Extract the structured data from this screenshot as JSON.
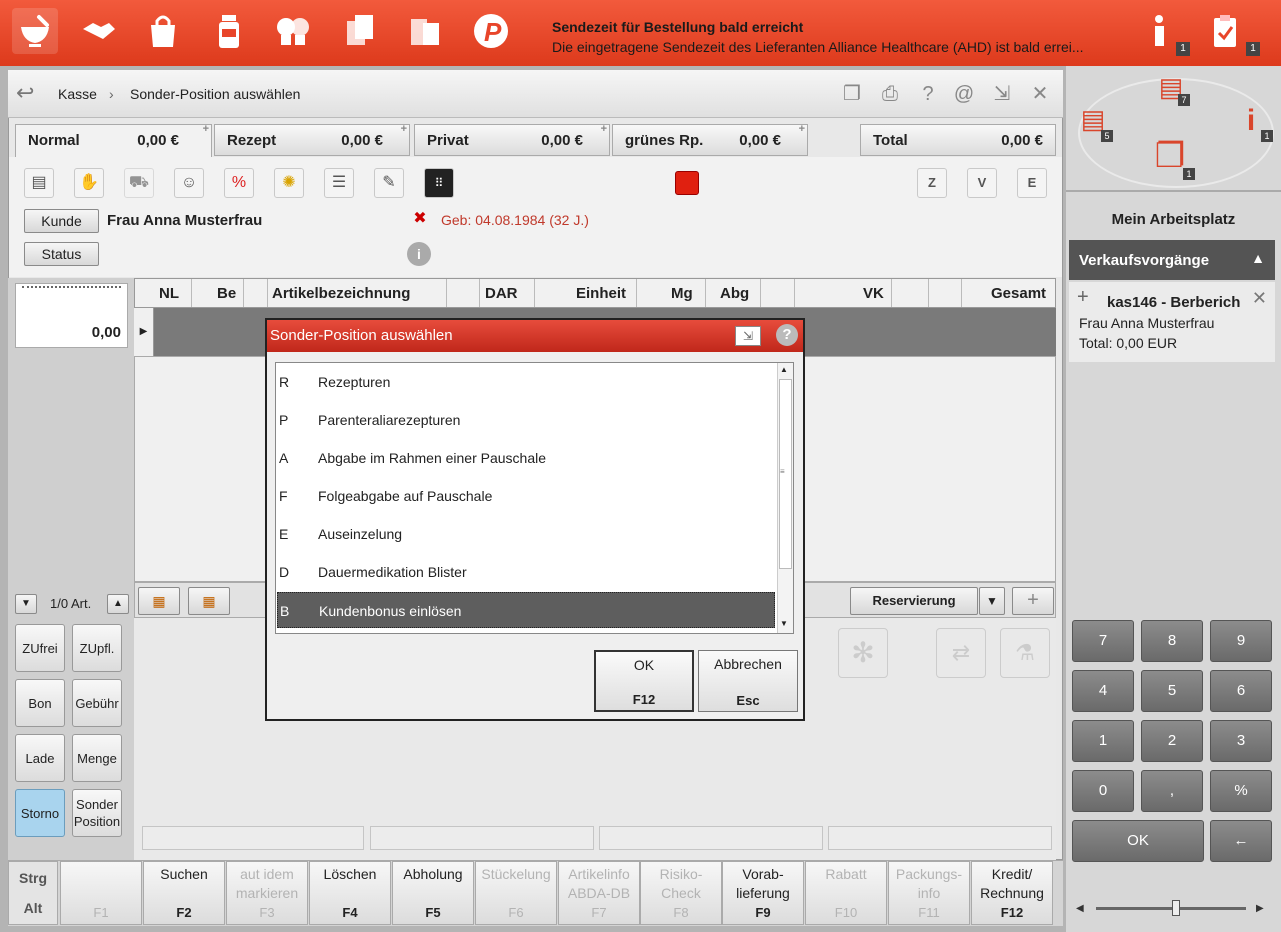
{
  "topbar": {
    "icons": [
      "mortar-icon",
      "handshake-icon",
      "shopping-bag-icon",
      "pill-bottle-icon",
      "consultation-icon",
      "documents-icon",
      "files-icon",
      "p-logo-icon"
    ],
    "notification_title": "Sendezeit für Bestellung bald erreicht",
    "notification_text": "Die eingetragene Sendezeit des Lieferanten Alliance Healthcare (AHD) ist bald errei...",
    "info_badge": "1",
    "task_badge": "1"
  },
  "breadcrumb": {
    "root": "Kasse",
    "sep": "›",
    "current": "Sonder-Position auswählen"
  },
  "tabs": [
    {
      "label": "Normal",
      "value": "0,00 €"
    },
    {
      "label": "Rezept",
      "value": "0,00 €"
    },
    {
      "label": "Privat",
      "value": "0,00 €"
    },
    {
      "label": "grünes Rp.",
      "value": "0,00 €"
    }
  ],
  "total": {
    "label": "Total",
    "value": "0,00 €"
  },
  "customer": {
    "kunde_button": "Kunde",
    "name": "Frau Anna Musterfrau",
    "status_button": "Status",
    "birth": "Geb: 04.08.1984 (32 J.)"
  },
  "zve_icons": [
    "Z",
    "V",
    "E"
  ],
  "notepad_value": "0,00",
  "table": {
    "headers": [
      "NL",
      "Be",
      "Artikelbezeichnung",
      "DAR",
      "Einheit",
      "Mg",
      "Abg",
      "VK",
      "Gesamt"
    ]
  },
  "art_count": "1/0 Art.",
  "reservierung": "Reservierung",
  "side_buttons": [
    "ZUfrei",
    "ZUpfl.",
    "Bon",
    "Gebühr",
    "Lade",
    "Menge",
    "Storno",
    "Sonder Position"
  ],
  "fkeys": [
    {
      "label": "",
      "key": "F1",
      "disabled": true
    },
    {
      "label": "Suchen",
      "key": "F2",
      "disabled": false
    },
    {
      "label": "aut idem markieren",
      "key": "F3",
      "disabled": true
    },
    {
      "label": "Löschen",
      "key": "F4",
      "disabled": false
    },
    {
      "label": "Abholung",
      "key": "F5",
      "disabled": false
    },
    {
      "label": "Stückelung",
      "key": "F6",
      "disabled": true
    },
    {
      "label": "Artikelinfo ABDA-DB",
      "key": "F7",
      "disabled": true
    },
    {
      "label": "Risiko-Check",
      "key": "F8",
      "disabled": true
    },
    {
      "label": "Vorab-lieferung",
      "key": "F9",
      "disabled": false
    },
    {
      "label": "Rabatt",
      "key": "F10",
      "disabled": true
    },
    {
      "label": "Packungs-info",
      "key": "F11",
      "disabled": true
    },
    {
      "label": "Kredit/ Rechnung",
      "key": "F12",
      "disabled": false
    }
  ],
  "modifiers": {
    "strg": "Strg",
    "alt": "Alt"
  },
  "right": {
    "workspace_label": "Mein Arbeitsplatz",
    "badges": [
      "5",
      "7",
      "1",
      "1"
    ],
    "sales_header": "Verkaufsvorgänge",
    "sale": {
      "title": "kas146 - Berberich",
      "customer": "Frau Anna Musterfrau",
      "total": "Total: 0,00 EUR"
    },
    "numpad": [
      "7",
      "8",
      "9",
      "4",
      "5",
      "6",
      "1",
      "2",
      "3",
      "0",
      ",",
      "%"
    ],
    "ok": "OK",
    "back": "←"
  },
  "dialog": {
    "title": "Sonder-Position auswählen",
    "items": [
      {
        "code": "R",
        "label": "Rezepturen"
      },
      {
        "code": "P",
        "label": "Parenteraliarezepturen"
      },
      {
        "code": "A",
        "label": "Abgabe im Rahmen einer Pauschale"
      },
      {
        "code": "F",
        "label": "Folgeabgabe auf Pauschale"
      },
      {
        "code": "E",
        "label": "Auseinzelung"
      },
      {
        "code": "D",
        "label": "Dauermedikation Blister"
      },
      {
        "code": "B",
        "label": "Kundenbonus einlösen"
      }
    ],
    "selected_index": 6,
    "ok_label": "OK",
    "ok_key": "F12",
    "cancel_label": "Abbrechen",
    "cancel_key": "Esc"
  },
  "colors": {
    "brand_red": "#e8452a",
    "selection": "#5e5e5e",
    "storno_blue": "#a9d4ee"
  }
}
